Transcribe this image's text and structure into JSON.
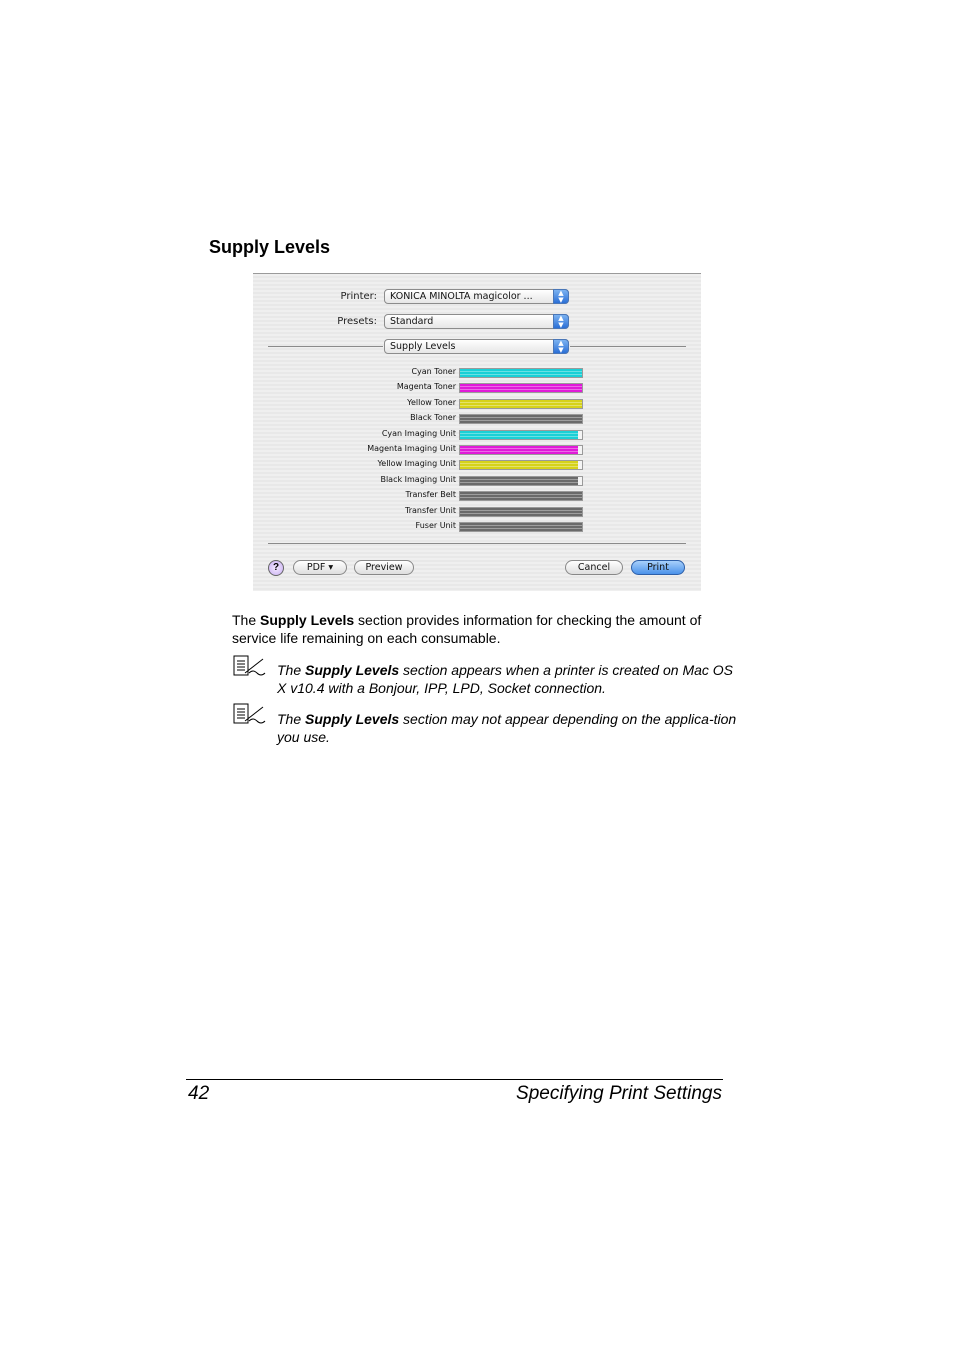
{
  "section_title": "Supply Levels",
  "dialog": {
    "printer_label": "Printer:",
    "printer_value": "KONICA MINOLTA magicolor ...",
    "presets_label": "Presets:",
    "presets_value": "Standard",
    "panel_value": "Supply Levels",
    "supplies": [
      {
        "name": "Cyan Toner",
        "level": 1.0,
        "color": "#1ad0d6"
      },
      {
        "name": "Magenta Toner",
        "level": 1.0,
        "color": "#e01ad8"
      },
      {
        "name": "Yellow Toner",
        "level": 1.0,
        "color": "#d6d21a"
      },
      {
        "name": "Black Toner",
        "level": 1.0,
        "color": "#6a6a6a"
      },
      {
        "name": "Cyan Imaging Unit",
        "level": 0.97,
        "color": "#1ad0d6"
      },
      {
        "name": "Magenta Imaging Unit",
        "level": 0.97,
        "color": "#e01ad8"
      },
      {
        "name": "Yellow Imaging Unit",
        "level": 0.97,
        "color": "#d6d21a"
      },
      {
        "name": "Black Imaging Unit",
        "level": 0.97,
        "color": "#6a6a6a"
      },
      {
        "name": "Transfer Belt",
        "level": 1.0,
        "color": "#6a6a6a"
      },
      {
        "name": "Transfer Unit",
        "level": 1.0,
        "color": "#6a6a6a"
      },
      {
        "name": "Fuser Unit",
        "level": 1.0,
        "color": "#6a6a6a"
      }
    ],
    "help_label": "?",
    "pdf_label": "PDF ▾",
    "preview_label": "Preview",
    "cancel_label": "Cancel",
    "print_label": "Print"
  },
  "body": {
    "intro_prefix": "The ",
    "intro_bold": "Supply Levels",
    "intro_suffix": " section provides information for checking the amount of service life remaining on each consumable.",
    "notes": [
      {
        "prefix": "The ",
        "bold": "Supply Levels",
        "suffix": " section appears when a printer is created on Mac OS X v10.4 with a Bonjour, IPP, LPD, Socket connection."
      },
      {
        "prefix": "The ",
        "bold": "Supply Levels",
        "suffix": " section may not appear depending on the applica-tion you use."
      }
    ]
  },
  "footer": {
    "page_number": "42",
    "chapter_title": "Specifying Print Settings"
  }
}
